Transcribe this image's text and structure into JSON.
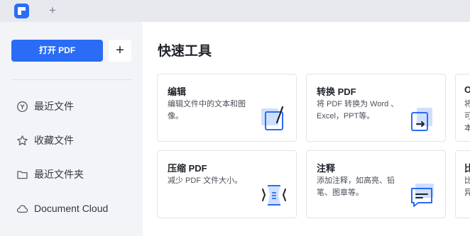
{
  "tabbar": {
    "new_tab": "+"
  },
  "sidebar": {
    "open_pdf_label": "打开 PDF",
    "add_label": "+",
    "items": [
      {
        "label": "最近文件",
        "icon": "clock-icon"
      },
      {
        "label": "收藏文件",
        "icon": "star-icon"
      },
      {
        "label": "最近文件夹",
        "icon": "folder-icon"
      },
      {
        "label": "Document Cloud",
        "icon": "cloud-icon"
      }
    ]
  },
  "main": {
    "title": "快速工具",
    "cards": [
      {
        "title": "编辑",
        "desc": "编辑文件中的文本和图像。",
        "icon": "edit-icon"
      },
      {
        "title": "转换 PDF",
        "desc": "将 PDF 转换为 Word 、Excel，PPT等。",
        "icon": "convert-icon"
      },
      {
        "title": "压缩 PDF",
        "desc": "减少 PDF 文件大小。",
        "icon": "compress-icon"
      },
      {
        "title": "注释",
        "desc": "添加注释，如高亮、铅笔、图章等。",
        "icon": "comment-icon"
      }
    ],
    "partial_cards": [
      {
        "title": "O",
        "desc": "将\n可\n本"
      },
      {
        "title": "比",
        "desc": "比\n异"
      }
    ]
  },
  "colors": {
    "accent": "#2b6cf6",
    "sidebar_bg": "#f3f4f7",
    "tabbar_bg": "#e7e9ee"
  }
}
